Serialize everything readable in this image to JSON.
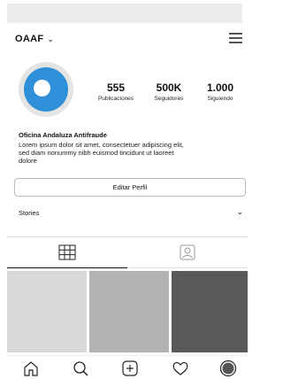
{
  "profile": {
    "username": "OAAF",
    "avatar_color": "#2f8fd8"
  },
  "stats": [
    {
      "value": "555",
      "label": "Publicaciones"
    },
    {
      "value": "500K",
      "label": "Seguidores"
    },
    {
      "value": "1.000",
      "label": "Siguiendo"
    }
  ],
  "bio": {
    "name": "Oficina Andaluza Antifraude",
    "text": "Lorem ipsum dolor sit amet, consectetuer adipiscing elit, sed diam nonummy nibh euismod tincidunt ut laoreet dolore"
  },
  "edit_profile": {
    "label": "Editar Perfil"
  },
  "stories": {
    "label": "Stories"
  },
  "tabs": [
    {
      "icon": "grid-icon",
      "active": true
    },
    {
      "icon": "tagged-portrait-icon",
      "active": false
    }
  ],
  "posts": [
    {
      "color": "#d9d9d9"
    },
    {
      "color": "#b3b3b3"
    },
    {
      "color": "#595959"
    }
  ],
  "nav": [
    "home-icon",
    "search-icon",
    "add-post-icon",
    "heart-icon",
    "profile-avatar-icon"
  ]
}
